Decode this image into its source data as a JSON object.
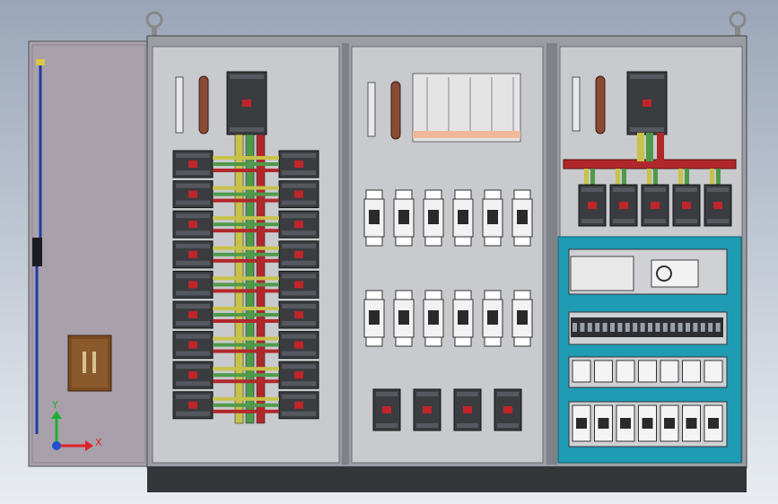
{
  "colors": {
    "bg_top": "#9aa6b8",
    "bg_bottom": "#e9edf2",
    "cabinet_frame": "#9a9ea4",
    "cabinet_panel": "#c8cacd",
    "door": "#a8a0aa",
    "plinth": "#333538",
    "breaker_body": "#3a3c40",
    "breaker_red": "#c0252a",
    "bus_red": "#b0282c",
    "bus_yellow": "#c9c24a",
    "bus_green": "#4f9a4a",
    "copper": "#8a4a36",
    "plc_frame": "#1f9bb4",
    "fuse_white": "#f2f2f2",
    "axis_x": "#e0202a",
    "axis_y": "#20b030",
    "axis_origin": "#2050d0"
  },
  "axis": {
    "x_label": "X",
    "y_label": "Y"
  }
}
